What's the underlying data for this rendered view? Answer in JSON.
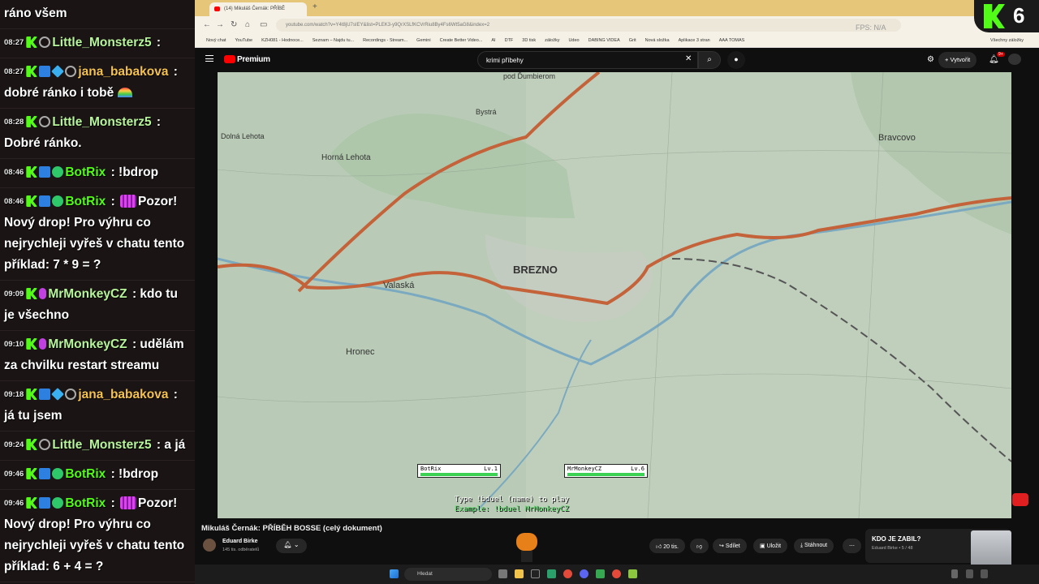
{
  "chat": {
    "messages": [
      {
        "time": "",
        "user": "",
        "user_color": "#ffffff",
        "text": "ráno všem",
        "badges": []
      },
      {
        "time": "08:27",
        "user": "Little_Monsterz5",
        "user_color": "#b7f59a",
        "text": "",
        "badges": [
          "k",
          "ring"
        ]
      },
      {
        "time": "08:27",
        "user": "jana_babakova",
        "user_color": "#f5c24e",
        "text": "dobré ránko i tobě",
        "badges": [
          "k",
          "blue",
          "cube",
          "ring"
        ]
      },
      {
        "time": "08:28",
        "user": "Little_Monsterz5",
        "user_color": "#b7f59a",
        "text": "Dobré ránko.",
        "badges": [
          "k",
          "ring"
        ]
      },
      {
        "time": "08:46",
        "user": "BotRix",
        "user_color": "#53fc18",
        "text": "!bdrop",
        "badges": [
          "k",
          "blue",
          "check"
        ]
      },
      {
        "time": "08:46",
        "user": "BotRix",
        "user_color": "#53fc18",
        "text": "Pozor! Nový drop! Pro výhru co nejrychleji vyřeš v chatu tento příklad: 7 * 9 = ?",
        "badges": [
          "k",
          "blue",
          "check"
        ]
      },
      {
        "time": "09:09",
        "user": "MrMonkeyCZ",
        "user_color": "#b7f59a",
        "text": "kdo tu je všechno",
        "badges": [
          "k",
          "mic"
        ]
      },
      {
        "time": "09:10",
        "user": "MrMonkeyCZ",
        "user_color": "#b7f59a",
        "text": "udělám za chvilku restart streamu",
        "badges": [
          "k",
          "mic"
        ]
      },
      {
        "time": "09:18",
        "user": "jana_babakova",
        "user_color": "#f5c24e",
        "text": "já tu jsem",
        "badges": [
          "k",
          "blue",
          "cube",
          "ring"
        ]
      },
      {
        "time": "09:24",
        "user": "Little_Monsterz5",
        "user_color": "#b7f59a",
        "text": "a já",
        "badges": [
          "k",
          "ring"
        ]
      },
      {
        "time": "09:46",
        "user": "BotRix",
        "user_color": "#53fc18",
        "text": "!bdrop",
        "badges": [
          "k",
          "blue",
          "check"
        ]
      },
      {
        "time": "09:46",
        "user": "BotRix",
        "user_color": "#53fc18",
        "text": "Pozor! Nový drop! Pro výhru co nejrychleji vyřeš v chatu tento příklad: 6 + 4 = ?",
        "badges": [
          "k",
          "blue",
          "check"
        ]
      }
    ]
  },
  "browser": {
    "tab_title": "(14) Mikuláš Černák: PŘÍBĚ",
    "url": "youtube.com/watch?v=Y4t8jU7sIEY&list=PLEK3-y9QrXSLfKCVrRiu8By4Fs6Wt5aG8&index=2",
    "bookmarks": [
      "Nový chat",
      "YouTube",
      "KZH081 - Hodnoce...",
      "Seznam – Najdu tu...",
      "Recordings - Stream...",
      "Gemini",
      "Create Better Video...",
      "AI",
      "DTF",
      "3D tisk",
      "záložky",
      "Udeo",
      "DABING VIDEA",
      "Grit",
      "Nová složka",
      "Aplikace 3 stran",
      "AAA TOMAS"
    ],
    "bookmarks_all": "Všechny záložky",
    "hud_fps": "FPS: N/A",
    "hud_cpu": "CPU: 44 s",
    "kick_count": "6"
  },
  "youtube": {
    "brand": "Premium",
    "search_query": "krimi příbehy",
    "create_label": "Vytvořit",
    "notif_count": "9+",
    "video_title": "Mikuláš Černák: PŘÍBĚH BOSSE (celý dokument)",
    "channel_name": "Eduard Birke",
    "subscribers": "145 tis. odběratelů",
    "likes": "20 tis.",
    "share": "Sdílet",
    "save": "Uložit",
    "download": "Stáhnout",
    "next_title": "KDO JE ZABIL?",
    "next_sub": "Eduard Birke • 5 / 48"
  },
  "map": {
    "labels": [
      "BREZNO",
      "Valaská",
      "Hronec",
      "Horná Lehota",
      "Dolná Lehota",
      "Bystrá",
      "Bravcovo",
      "pod Ďumbierom"
    ]
  },
  "duel": {
    "player1": "BotRix",
    "player1_level": "Lv.1",
    "player1_hp": 1.0,
    "player2": "MrMonkeyCZ",
    "player2_level": "Lv.6",
    "player2_hp": 1.0,
    "hp_label": "HP:",
    "line1": "Type !bduel (name) to play",
    "line2": "Example: !bduel MrMonkeyCZ"
  },
  "taskbar": {
    "search_placeholder": "Hledat"
  }
}
